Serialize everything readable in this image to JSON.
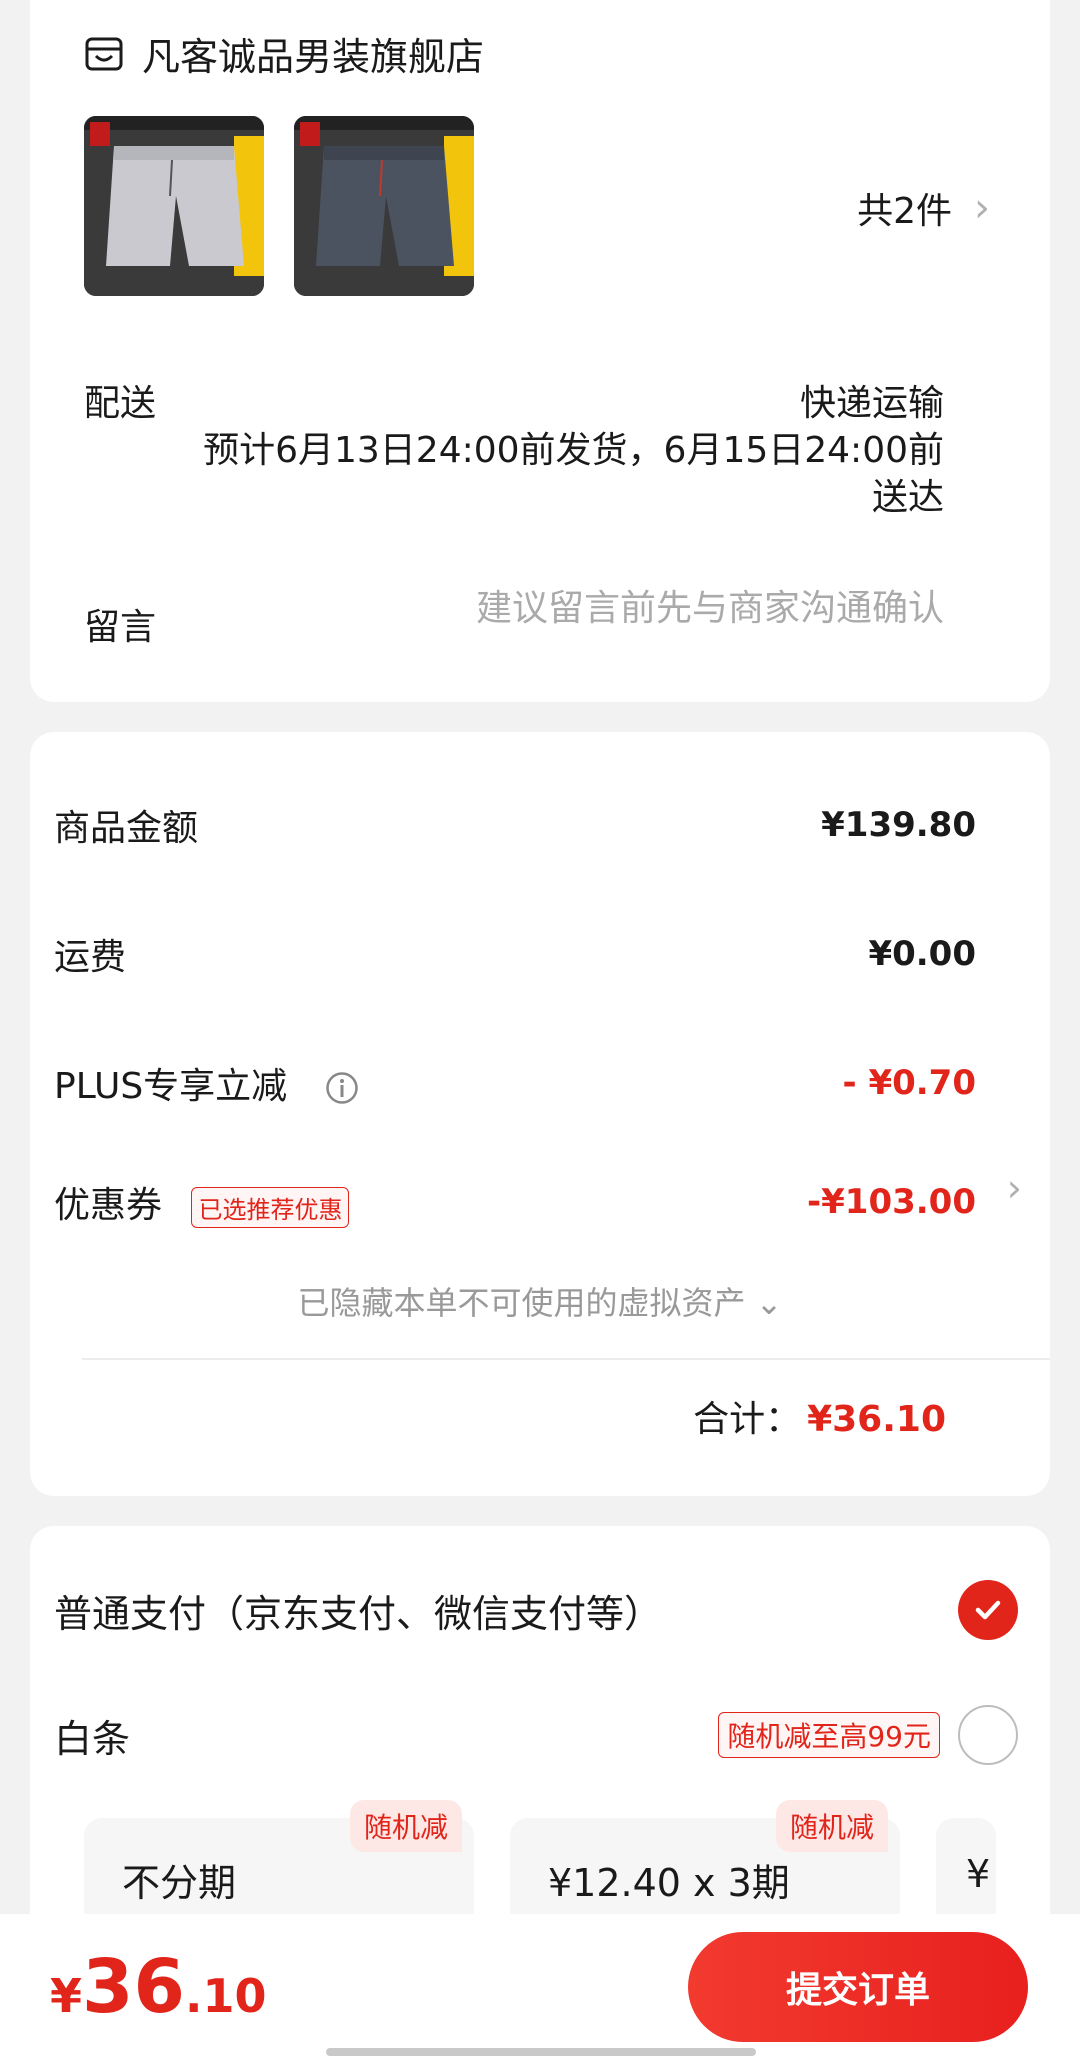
{
  "store": {
    "name": "凡客诚品男装旗舰店",
    "icon": "store-icon",
    "quantity_label": "共2件"
  },
  "delivery": {
    "label": "配送",
    "method": "快递运输",
    "estimate": "预计6月13日24:00前发货，6月15日24:00前送达"
  },
  "message": {
    "label": "留言",
    "placeholder": "建议留言前先与商家沟通确认"
  },
  "pricing": {
    "goods_label": "商品金额",
    "goods_value": "¥139.80",
    "shipping_label": "运费",
    "shipping_value": "¥0.00",
    "plus_label": "PLUS专享立减",
    "plus_value": "- ¥0.70",
    "coupon_label": "优惠券",
    "coupon_tag": "已选推荐优惠",
    "coupon_value": "-¥103.00",
    "hidden_assets": "已隐藏本单不可使用的虚拟资产 ⌄",
    "total_label": "合计：",
    "total_value": "¥36.10"
  },
  "payment": {
    "normal_label": "普通支付（京东支付、微信支付等）",
    "normal_selected": true,
    "baitiao_label": "白条",
    "baitiao_tag": "随机减至高99元",
    "plans": [
      {
        "tag": "随机减",
        "title": "不分期"
      },
      {
        "tag": "随机减",
        "title": "¥12.40 x 3期"
      },
      {
        "title": "¥"
      }
    ]
  },
  "bottom": {
    "yen": "¥",
    "amount_int": "36",
    "amount_dec": ".10",
    "submit_label": "提交订单"
  },
  "colors": {
    "accent": "#e1251b",
    "background": "#f2f2f2"
  }
}
